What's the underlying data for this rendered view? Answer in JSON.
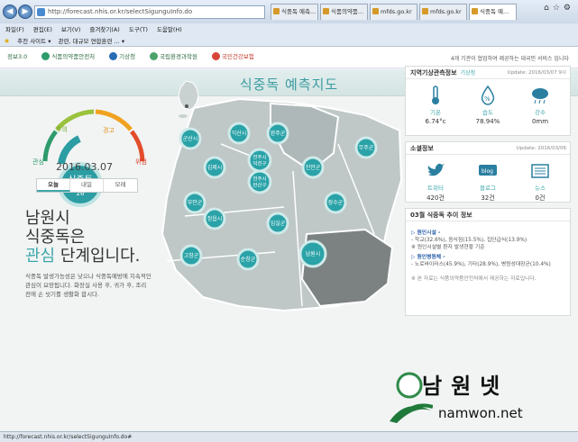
{
  "browser": {
    "url": "http://forecast.nhis.or.kr/selectSigunguInfo.do",
    "tabs": [
      {
        "label": "식중독 예측..."
      },
      {
        "label": "식품의약품..."
      },
      {
        "label": "mfds.go.kr"
      },
      {
        "label": "mfds.go.kr"
      },
      {
        "label": "식중독 예..."
      }
    ],
    "menu": [
      "파일(F)",
      "편집(E)",
      "보기(V)",
      "즐겨찾기(A)",
      "도구(T)",
      "도움말(H)"
    ],
    "favorites": [
      "추천 사이트 ▾",
      "관련, 대규모 연합훈련 ... ▾"
    ],
    "status_url": "http://forecast.nhis.or.kr/selectSigunguInfo.do#"
  },
  "header": {
    "logos": [
      "정보3.0",
      "식품의약품안전처",
      "기상청",
      "국립환경과학원",
      "국민건강보험"
    ],
    "notice": "4개 기관이 협업하여 제공하는 대국민 서비스 입니다"
  },
  "page_title": "식중독 예측지도",
  "gauge": {
    "levels": [
      "관심",
      "주의",
      "경고",
      "위험"
    ],
    "current_label": "식중독",
    "current_value": "26",
    "colors": {
      "level1": "#2e9b6a",
      "level2": "#9ac23c",
      "level3": "#f0a21f",
      "level4": "#e24d2b",
      "accent": "#3fa7ab"
    }
  },
  "forecast_date": "2016.03.07",
  "day_tabs": [
    "오늘",
    "내일",
    "모레"
  ],
  "headline": {
    "line1": "남원시",
    "line2": "식중독은",
    "level": "관심",
    "line3_rest": " 단계입니다."
  },
  "description": "식중독 발생가능성은 낮으나 식중독예방에 지속적인 관심이 요망됩니다. 화장실 사용 후, 귀가 후, 조리 전에 손 씻기를 생활화 합시다.",
  "map_regions": [
    "군산시",
    "익산시",
    "완주군",
    "전주시 덕진구",
    "전주시 완산구",
    "김제시",
    "진안군",
    "무주군",
    "부안군",
    "정읍시",
    "임실군",
    "장수군",
    "고창군",
    "순창군",
    "남원시"
  ],
  "weather": {
    "title": "지역기상관측정보",
    "source": "기상청",
    "updated": "Update: 2016/03/07 9시",
    "items": [
      {
        "icon": "thermometer-icon",
        "label": "기온",
        "value": "6.74°c"
      },
      {
        "icon": "humidity-icon",
        "label": "습도",
        "value": "78.94%"
      },
      {
        "icon": "rain-icon",
        "label": "강수",
        "value": "0mm"
      }
    ]
  },
  "social": {
    "title": "소셜정보",
    "updated": "Update: 2016/03/06",
    "items": [
      {
        "icon": "twitter-icon",
        "label": "트위터",
        "value": "420건"
      },
      {
        "icon": "blog-icon",
        "label": "블로그",
        "value": "32건"
      },
      {
        "icon": "news-icon",
        "label": "뉴스",
        "value": "0건"
      }
    ]
  },
  "trend": {
    "title": "03월 식중독 추이 정보",
    "cat1": "▷ 원인시설 -",
    "cat1_text": "- 학교(32.6%), 음식점(15.5%), 집단급식(13.9%)",
    "cat1_note": "※ 원인시설별 환자 발생현황 기준",
    "cat2": "▷ 원인병원체 -",
    "cat2_text": "- 노로바이러스(45.9%), 기타(28.9%), 병원성대장균(10.4%)",
    "footnote": "※ 본 자료는 식품의약품안전처에서 제공하는 자료입니다."
  },
  "watermark": {
    "brand": "남원넷",
    "url": "namwon.net"
  }
}
